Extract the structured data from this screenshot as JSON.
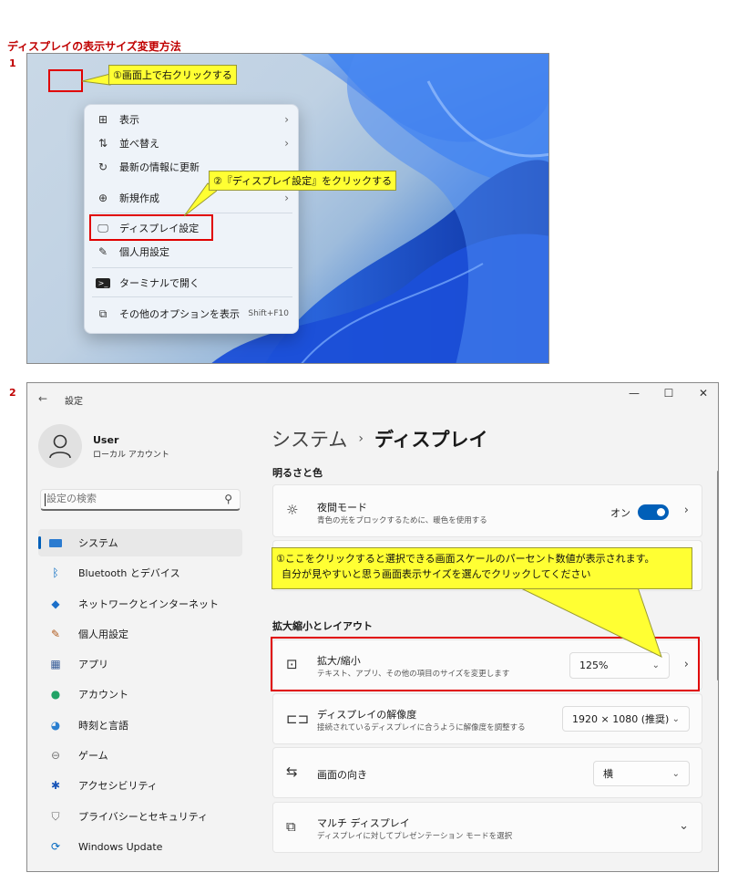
{
  "doc_title": "ディスプレイの表示サイズ変更方法",
  "step1_number": "1",
  "step2_number": "2",
  "context_menu": {
    "items": [
      {
        "label": "表示",
        "icon": "grid-icon",
        "arrow": "›"
      },
      {
        "label": "並べ替え",
        "icon": "sort-icon",
        "arrow": "›"
      },
      {
        "label": "最新の情報に更新",
        "icon": "refresh-icon"
      },
      {
        "label": "新規作成",
        "icon": "new-icon",
        "arrow": "›"
      },
      {
        "label": "ディスプレイ設定",
        "icon": "display-icon"
      },
      {
        "label": "個人用設定",
        "icon": "brush-icon"
      },
      {
        "label": "ターミナルで開く",
        "icon": "terminal-icon"
      },
      {
        "label": "その他のオプションを表示",
        "icon": "more-options-icon",
        "shortcut": "Shift+F10"
      }
    ]
  },
  "callouts": {
    "right_click": "①画面上で右クリックする",
    "display_settings": "②『ディスプレイ設定』をクリックする",
    "scale_hint_line1": "①ここをクリックすると選択できる画面スケールのパーセント数値が表示されます。",
    "scale_hint_line2": "自分が見やすいと思う画面表示サイズを選んでクリックしてください"
  },
  "settings": {
    "window_title": "設定",
    "back_glyph": "←",
    "window_controls": {
      "minimize": "—",
      "maximize": "☐",
      "close": "✕"
    },
    "user": {
      "name": "User",
      "account_type": "ローカル アカウント"
    },
    "search": {
      "placeholder": "設定の検索"
    },
    "nav": [
      {
        "label": "システム",
        "icon": "system-icon",
        "active": true
      },
      {
        "label": "Bluetooth とデバイス",
        "icon": "bluetooth-icon"
      },
      {
        "label": "ネットワークとインターネット",
        "icon": "network-icon"
      },
      {
        "label": "個人用設定",
        "icon": "personalize-icon"
      },
      {
        "label": "アプリ",
        "icon": "apps-icon"
      },
      {
        "label": "アカウント",
        "icon": "account-icon"
      },
      {
        "label": "時刻と言語",
        "icon": "time-language-icon"
      },
      {
        "label": "ゲーム",
        "icon": "gaming-icon"
      },
      {
        "label": "アクセシビリティ",
        "icon": "accessibility-icon"
      },
      {
        "label": "プライバシーとセキュリティ",
        "icon": "privacy-icon"
      },
      {
        "label": "Windows Update",
        "icon": "windows-update-icon"
      }
    ],
    "breadcrumb": {
      "parent": "システム",
      "separator": "›",
      "current": "ディスプレイ"
    },
    "section_brightness": "明るさと色",
    "night_light": {
      "title": "夜間モード",
      "subtitle": "青色の光をブロックするために、暖色を使用する",
      "state": "オン"
    },
    "section_scale_layout": "拡大縮小とレイアウト",
    "scale": {
      "title": "拡大/縮小",
      "subtitle": "テキスト、アプリ、その他の項目のサイズを変更します",
      "value": "125%"
    },
    "resolution": {
      "title": "ディスプレイの解像度",
      "subtitle": "接続されているディスプレイに合うように解像度を調整する",
      "value": "1920 × 1080 (推奨)"
    },
    "orientation": {
      "title": "画面の向き",
      "value": "横"
    },
    "multi_display": {
      "title": "マルチ ディスプレイ",
      "subtitle": "ディスプレイに対してプレゼンテーション モードを選択"
    }
  },
  "colors": {
    "accent": "#005fb8",
    "annotation_red": "#e00000",
    "callout_yellow": "#ffff33",
    "title_red": "#c00000"
  }
}
